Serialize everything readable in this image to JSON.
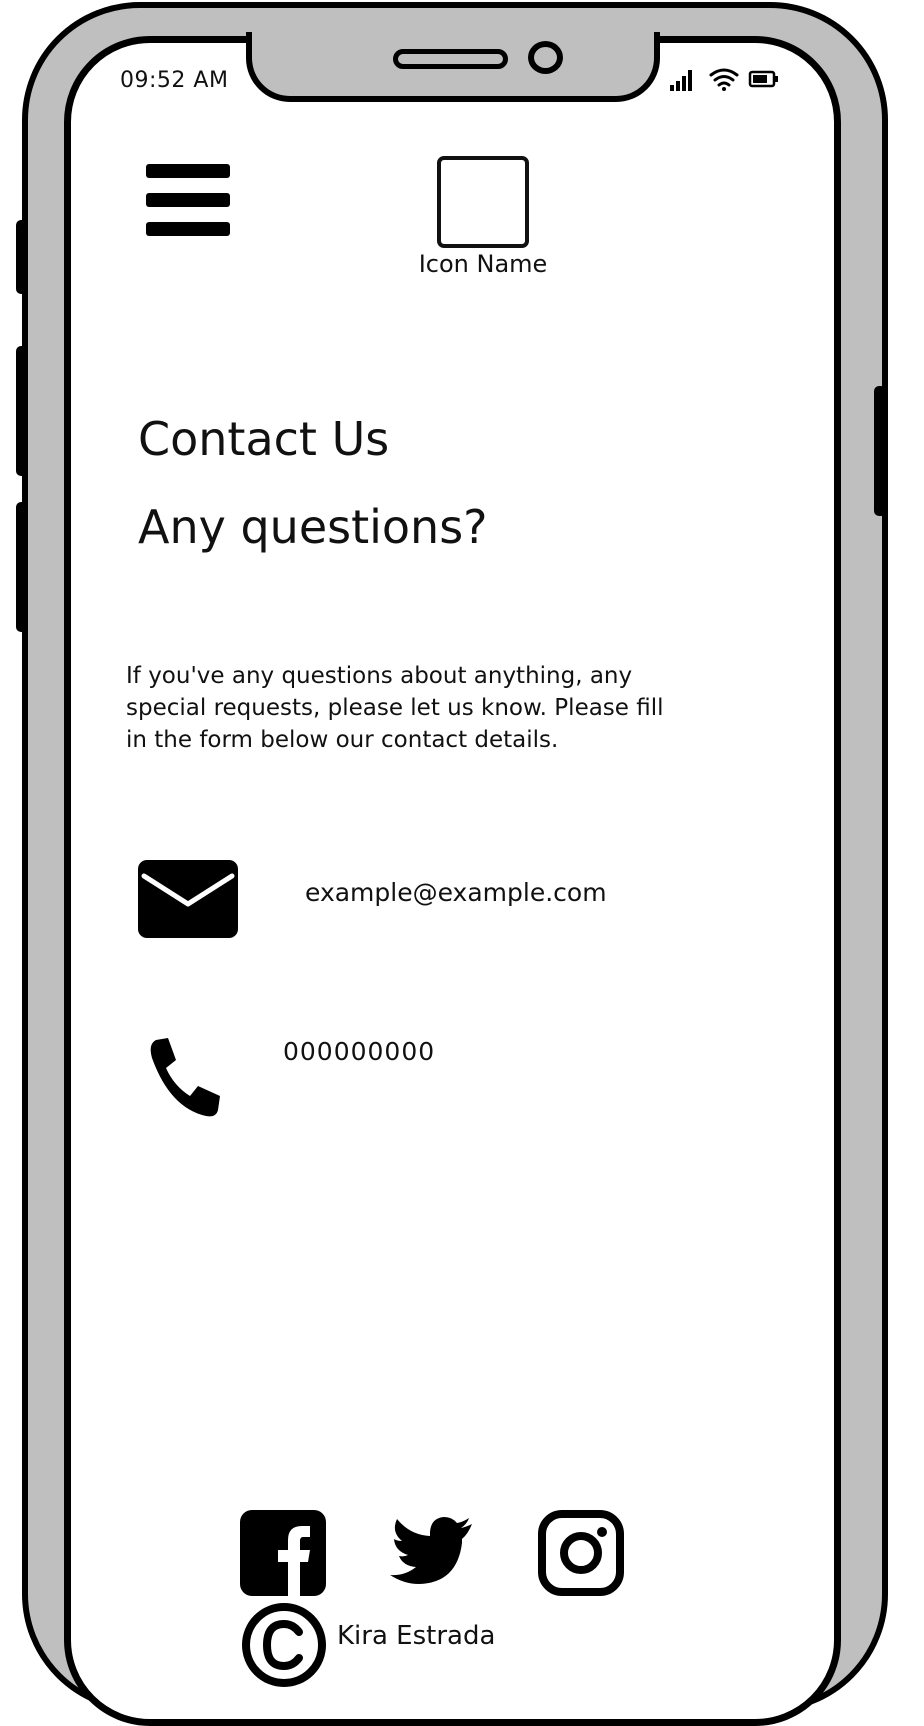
{
  "status_bar": {
    "time": "09:52 AM"
  },
  "header": {
    "logo_label": "Icon Name"
  },
  "main": {
    "title": "Contact Us",
    "subtitle": "Any questions?",
    "intro": "If you've any questions about anything, any special requests, please let us know. Please fill in the form below our contact details.",
    "email": "example@example.com",
    "phone": "000000000"
  },
  "footer": {
    "credit": "Kira Estrada",
    "social_icons": [
      "facebook-icon",
      "twitter-icon",
      "instagram-icon"
    ]
  }
}
